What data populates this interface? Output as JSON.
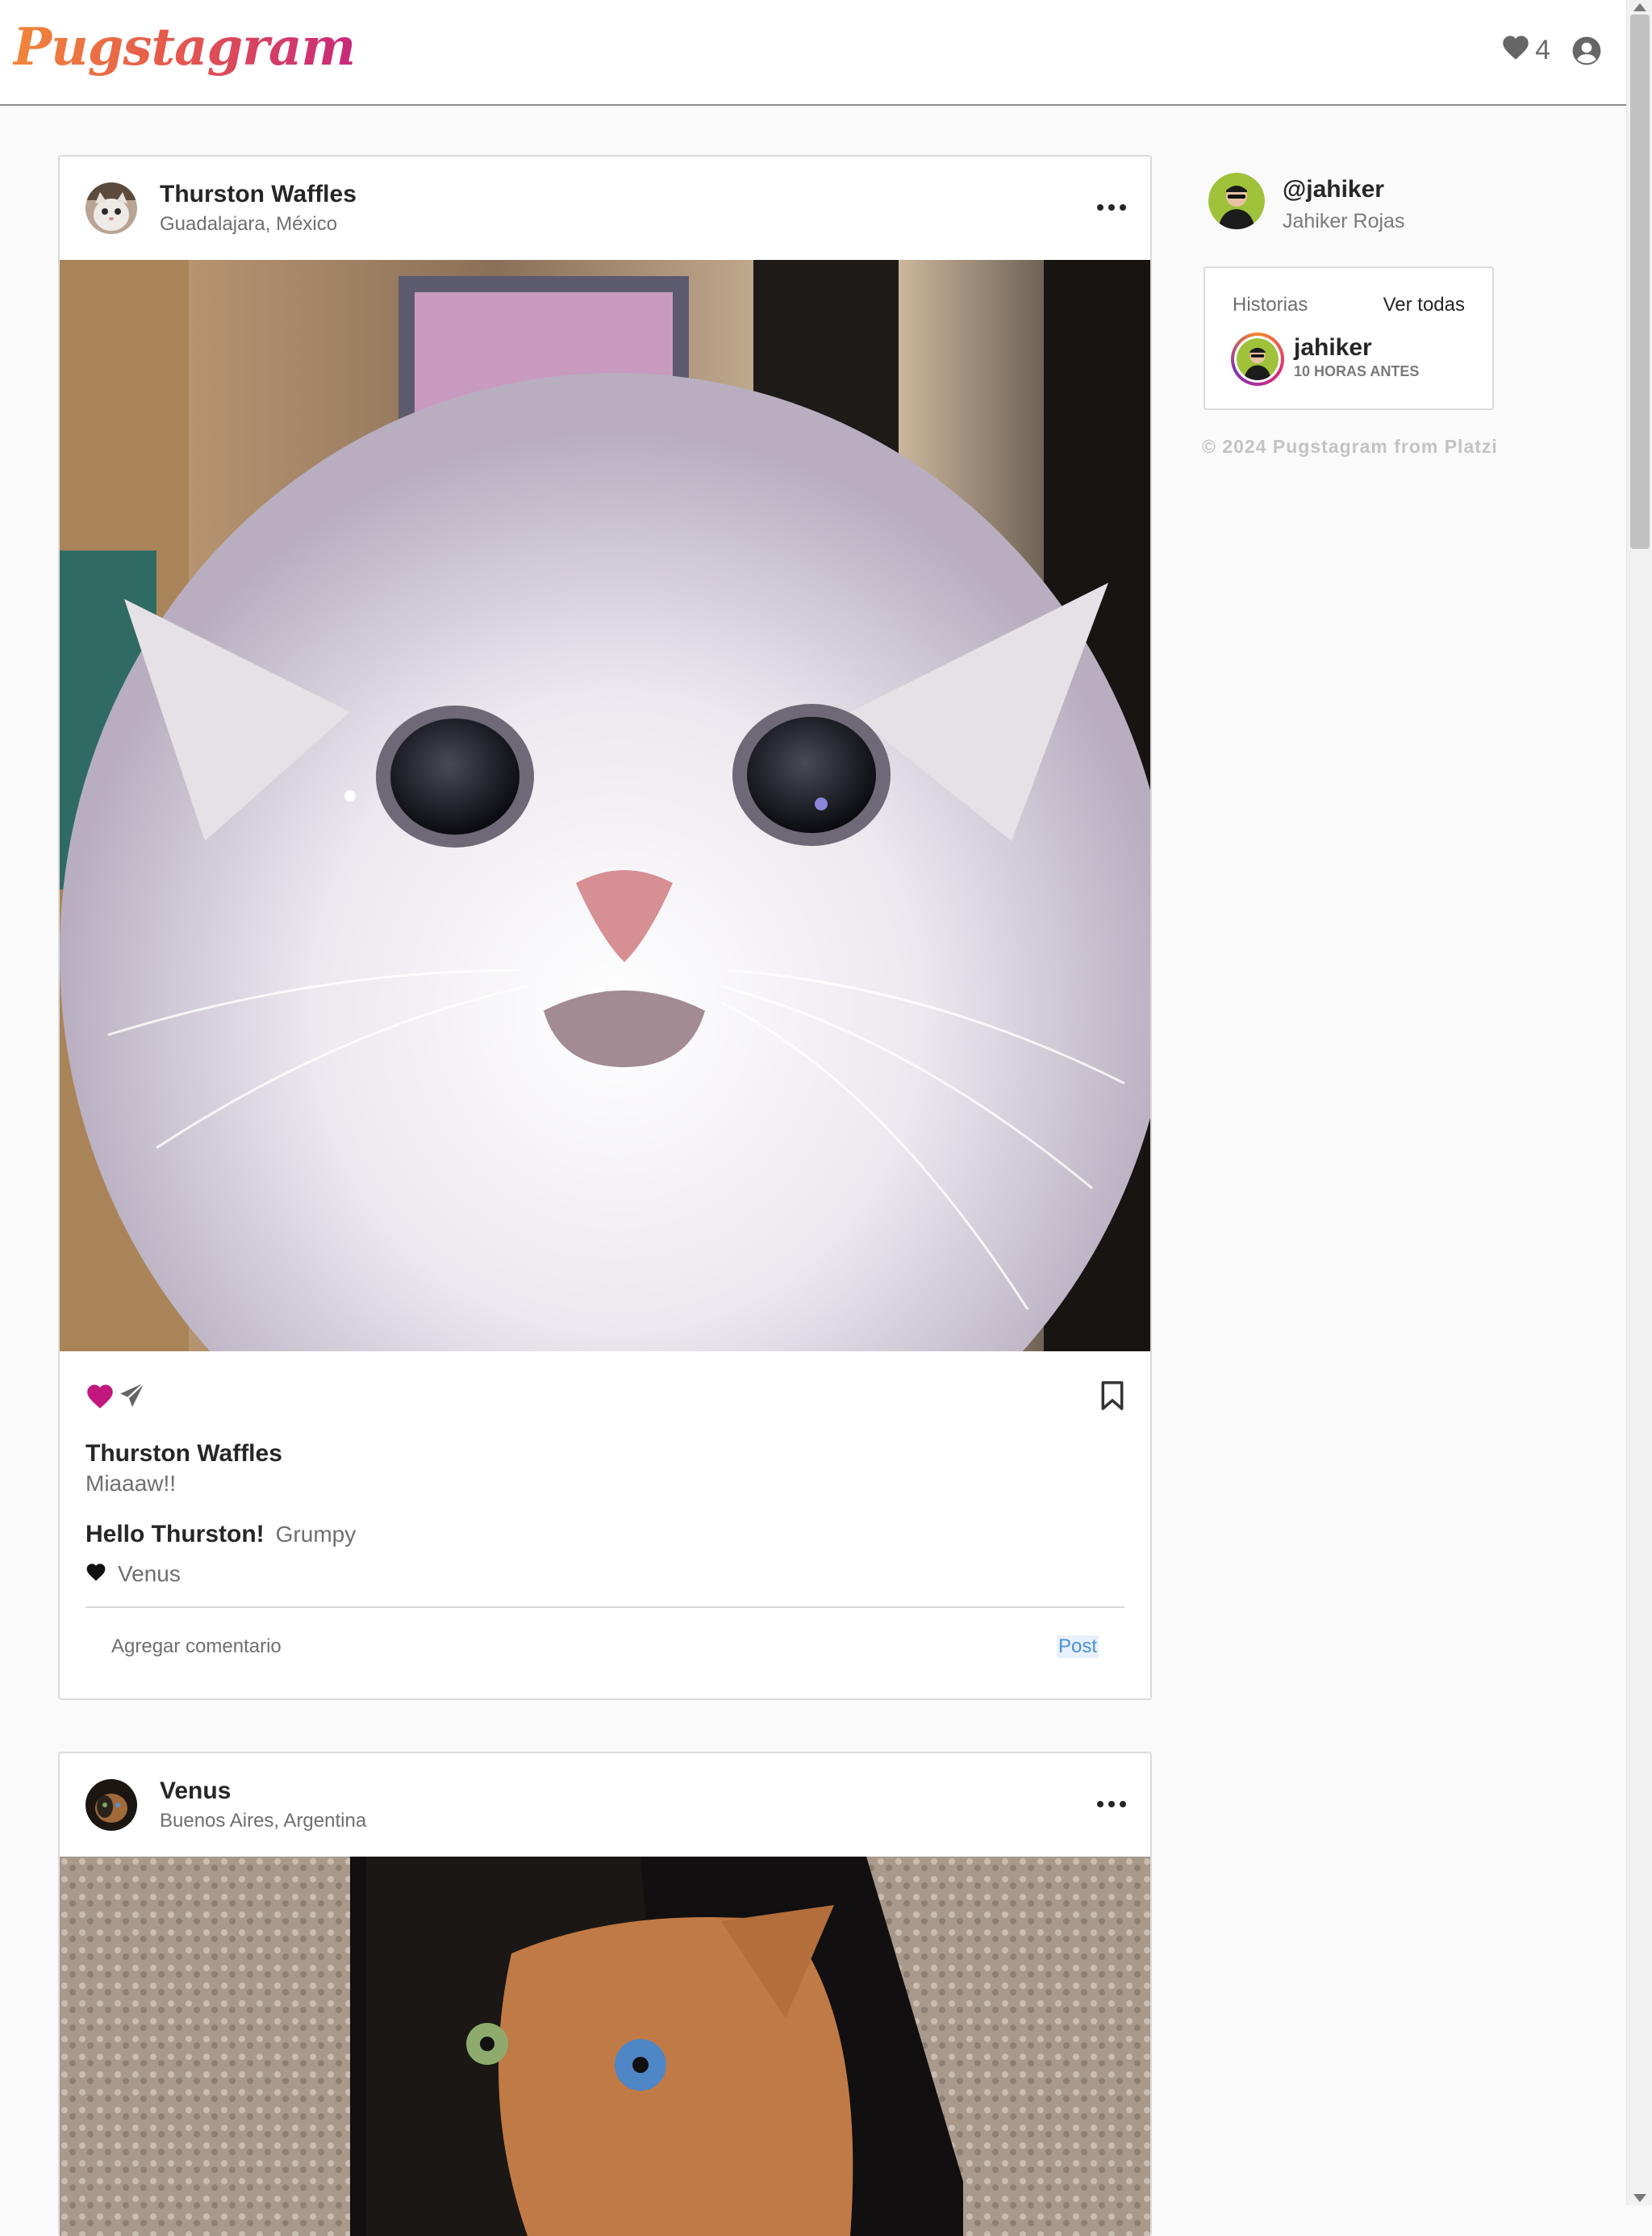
{
  "app": {
    "logo_text": "Pugstagram",
    "brand_gradient": [
      "#f0863a",
      "#e65a4c",
      "#c8287a"
    ],
    "like_count": "4",
    "header_icons": [
      "heart-icon",
      "user-circle-icon"
    ]
  },
  "posts": [
    {
      "user": "Thurston Waffles",
      "location": "Guadalajara, México",
      "image_subject": "white cat close-up",
      "liked": true,
      "like_color": "#c2187e",
      "caption_user": "Thurston Waffles",
      "caption_text": "Miaaaw!!",
      "comment_title": "Hello Thurston!",
      "comment_author": "Grumpy",
      "liked_by": "Venus",
      "comment_placeholder": "Agregar comentario",
      "post_label": "Post"
    },
    {
      "user": "Venus",
      "location": "Buenos Aires, Argentina",
      "image_subject": "two-faced cat"
    }
  ],
  "sidebar": {
    "handle": "@jahiker",
    "name": "Jahiker Rojas",
    "stories_title": "Historias",
    "stories_all": "Ver todas",
    "story_user": "jahiker",
    "story_time": "10 HORAS ANTES",
    "copyright": "© 2024 Pugstagram from Platzi"
  }
}
